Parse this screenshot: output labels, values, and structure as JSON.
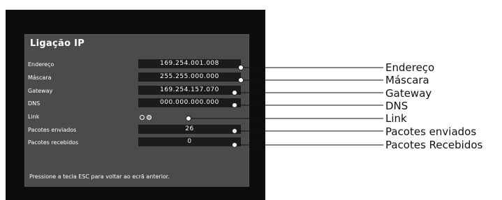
{
  "panel": {
    "title": "Ligação IP",
    "rows": [
      {
        "label": "Endereço",
        "value": "169.254.001.008"
      },
      {
        "label": "Máscara",
        "value": "255.255.000.000"
      },
      {
        "label": "Gateway",
        "value": "169.254.157.070"
      },
      {
        "label": "DNS",
        "value": "000.000.000.000"
      },
      {
        "label": "Link",
        "value": ""
      },
      {
        "label": "Pacotes enviados",
        "value": "26"
      },
      {
        "label": "Pacotes recebidos",
        "value": "0"
      }
    ],
    "footer": "Pressione a tecla ESC para voltar ao ecrã anterior."
  },
  "callouts": [
    "Endereço",
    "Máscara",
    "Gateway",
    "DNS",
    "Link",
    "Pacotes enviados",
    "Pacotes Recebidos"
  ],
  "colors": {
    "screen": "#0d0d0d",
    "panel": "#4b4b4b",
    "value_box": "#1b1b1b",
    "callout_line": "#111111"
  }
}
